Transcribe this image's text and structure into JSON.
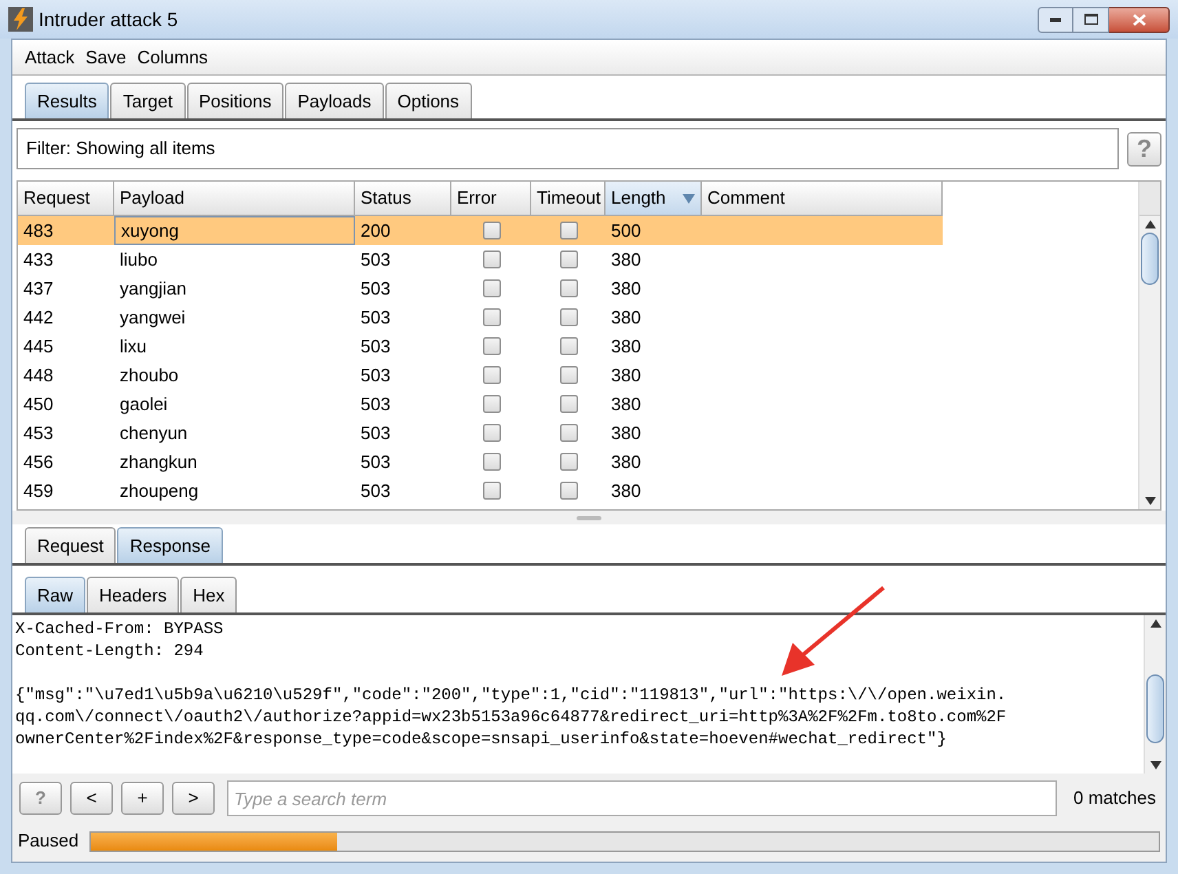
{
  "window": {
    "title": "Intruder attack 5"
  },
  "menu": [
    "Attack",
    "Save",
    "Columns"
  ],
  "tabs": [
    {
      "label": "Results",
      "selected": true
    },
    {
      "label": "Target",
      "selected": false
    },
    {
      "label": "Positions",
      "selected": false
    },
    {
      "label": "Payloads",
      "selected": false
    },
    {
      "label": "Options",
      "selected": false
    }
  ],
  "filter": {
    "text": "Filter: Showing all items",
    "help": "?"
  },
  "table": {
    "columns": [
      {
        "label": "Request",
        "sorted": false
      },
      {
        "label": "Payload",
        "sorted": false
      },
      {
        "label": "Status",
        "sorted": false
      },
      {
        "label": "Error",
        "sorted": false
      },
      {
        "label": "Timeout",
        "sorted": false
      },
      {
        "label": "Length",
        "sorted": true
      },
      {
        "label": "Comment",
        "sorted": false
      }
    ],
    "rows": [
      {
        "request": "483",
        "payload": "xuyong",
        "status": "200",
        "error": false,
        "timeout": false,
        "length": "500",
        "selected": true
      },
      {
        "request": "433",
        "payload": "liubo",
        "status": "503",
        "error": false,
        "timeout": false,
        "length": "380",
        "selected": false
      },
      {
        "request": "437",
        "payload": "yangjian",
        "status": "503",
        "error": false,
        "timeout": false,
        "length": "380",
        "selected": false
      },
      {
        "request": "442",
        "payload": "yangwei",
        "status": "503",
        "error": false,
        "timeout": false,
        "length": "380",
        "selected": false
      },
      {
        "request": "445",
        "payload": "lixu",
        "status": "503",
        "error": false,
        "timeout": false,
        "length": "380",
        "selected": false
      },
      {
        "request": "448",
        "payload": "zhoubo",
        "status": "503",
        "error": false,
        "timeout": false,
        "length": "380",
        "selected": false
      },
      {
        "request": "450",
        "payload": "gaolei",
        "status": "503",
        "error": false,
        "timeout": false,
        "length": "380",
        "selected": false
      },
      {
        "request": "453",
        "payload": "chenyun",
        "status": "503",
        "error": false,
        "timeout": false,
        "length": "380",
        "selected": false
      },
      {
        "request": "456",
        "payload": "zhangkun",
        "status": "503",
        "error": false,
        "timeout": false,
        "length": "380",
        "selected": false
      },
      {
        "request": "459",
        "payload": "zhoupeng",
        "status": "503",
        "error": false,
        "timeout": false,
        "length": "380",
        "selected": false
      }
    ]
  },
  "message_tabs": [
    {
      "label": "Request",
      "selected": false
    },
    {
      "label": "Response",
      "selected": true
    }
  ],
  "view_tabs": [
    {
      "label": "Raw",
      "selected": true
    },
    {
      "label": "Headers",
      "selected": false
    },
    {
      "label": "Hex",
      "selected": false
    }
  ],
  "response_headers": [
    "X-Cached-From: BYPASS",
    "Content-Length: 294"
  ],
  "response_body": [
    "{\"msg\":\"\\u7ed1\\u5b9a\\u6210\\u529f\",\"code\":\"200\",\"type\":1,\"cid\":\"119813\",\"url\":\"https:\\/\\/open.weixin.",
    "qq.com\\/connect\\/oauth2\\/authorize?appid=wx23b5153a96c64877&redirect_uri=http%3A%2F%2Fm.to8to.com%2F",
    "ownerCenter%2Findex%2F&response_type=code&scope=snsapi_userinfo&state=hoeven#wechat_redirect\"}"
  ],
  "search": {
    "buttons": [
      "?",
      "<",
      "+",
      ">"
    ],
    "placeholder": "Type a search term",
    "matches": "0 matches"
  },
  "status": {
    "text": "Paused",
    "level": 0.23
  }
}
